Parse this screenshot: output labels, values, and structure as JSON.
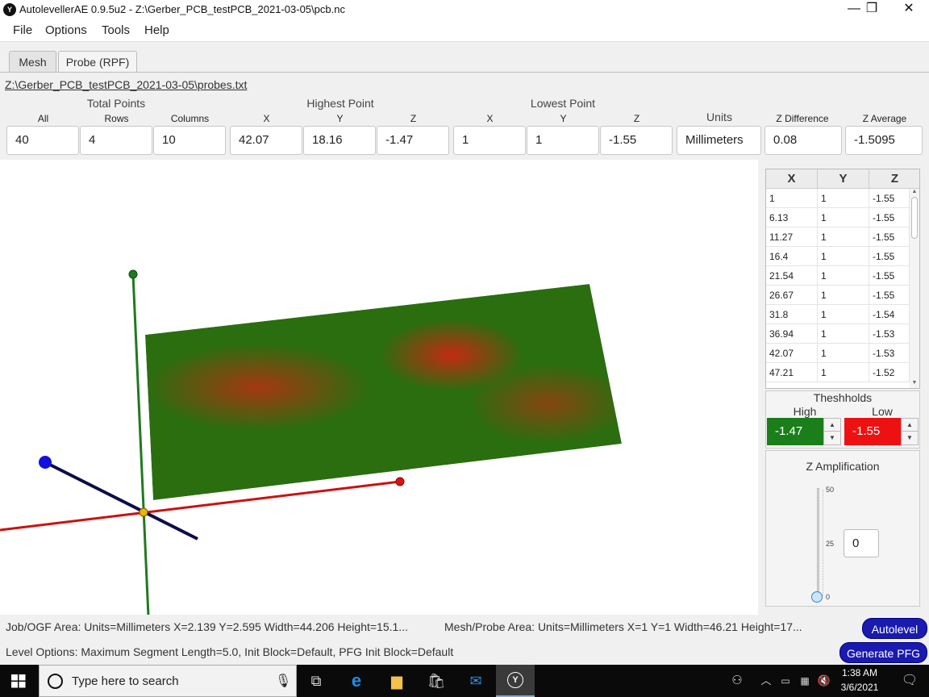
{
  "window": {
    "title": "AutolevellerAE 0.9.5u2 - Z:\\Gerber_PCB_testPCB_2021-03-05\\pcb.nc",
    "icon_letter": "Y",
    "minimize": "—",
    "maximize": "❐",
    "close": "✕"
  },
  "menu": [
    "File",
    "Options",
    "Tools",
    "Help"
  ],
  "tabs": [
    "Mesh",
    "Probe (RPF)"
  ],
  "active_tab": "Probe (RPF)",
  "file_path": "Z:\\Gerber_PCB_testPCB_2021-03-05\\probes.txt",
  "summary": {
    "groups": [
      "Total Points",
      "Highest Point",
      "Lowest Point",
      "Units"
    ],
    "cols": [
      "All",
      "Rows",
      "Columns",
      "X",
      "Y",
      "Z",
      "X",
      "Y",
      "Z",
      "Z Difference",
      "Z Average"
    ],
    "values": {
      "all": "40",
      "rows": "4",
      "columns": "10",
      "high_x": "42.07",
      "high_y": "18.16",
      "high_z": "-1.47",
      "low_x": "1",
      "low_y": "1",
      "low_z": "-1.55",
      "units": "Millimeters",
      "z_diff": "0.08",
      "z_avg": "-1.5095"
    }
  },
  "probe_table": {
    "headers": [
      "X",
      "Y",
      "Z"
    ],
    "rows": [
      [
        "1",
        "1",
        "-1.55"
      ],
      [
        "6.13",
        "1",
        "-1.55"
      ],
      [
        "11.27",
        "1",
        "-1.55"
      ],
      [
        "16.4",
        "1",
        "-1.55"
      ],
      [
        "21.54",
        "1",
        "-1.55"
      ],
      [
        "26.67",
        "1",
        "-1.55"
      ],
      [
        "31.8",
        "1",
        "-1.54"
      ],
      [
        "36.94",
        "1",
        "-1.53"
      ],
      [
        "42.07",
        "1",
        "-1.53"
      ],
      [
        "47.21",
        "1",
        "-1.52"
      ]
    ]
  },
  "thresholds": {
    "title": "Theshholds",
    "high_label": "High",
    "low_label": "Low",
    "high_value": "-1.47",
    "low_value": "-1.55",
    "high_color": "#1a7f1a",
    "low_color": "#ee1111"
  },
  "amplification": {
    "title": "Z Amplification",
    "ticks": [
      "50",
      "25",
      "0"
    ],
    "value": "0",
    "slider_level": 0
  },
  "status": {
    "job_area": "Job/OGF Area: Units=Millimeters X=2.139 Y=2.595 Width=44.206 Height=15.1...",
    "mesh_area": "Mesh/Probe Area: Units=Millimeters X=1 Y=1 Width=46.21 Height=17...",
    "level_options": "Level Options: Maximum Segment Length=5.0, Init Block=Default, PFG Init Block=Default",
    "autolevel_btn": "Autolevel",
    "generate_btn": "Generate PFG"
  },
  "taskbar": {
    "search_placeholder": "Type here to search",
    "time": "1:38 AM",
    "date": "3/6/2021"
  }
}
